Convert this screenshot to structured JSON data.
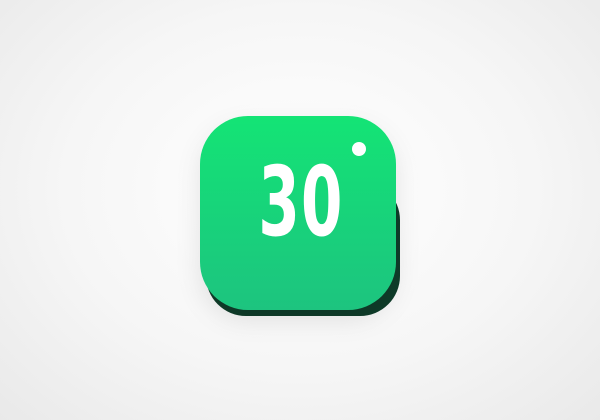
{
  "app_icon": {
    "number": "30",
    "accent_color": "#17D57A",
    "dot_icon": "dot-icon"
  }
}
